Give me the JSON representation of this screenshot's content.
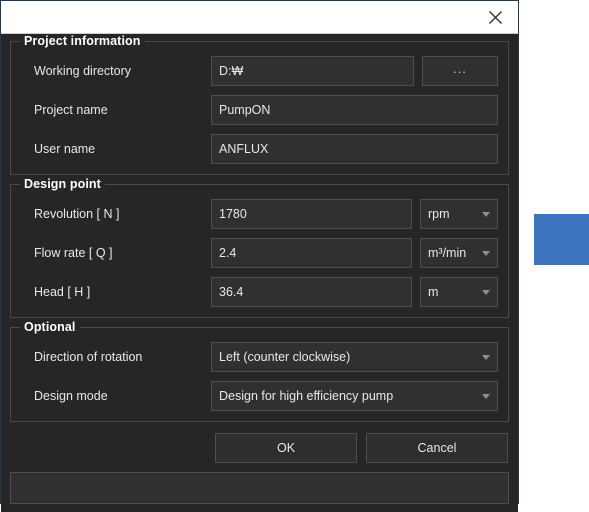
{
  "window": {
    "title": "",
    "close_icon": "close-icon"
  },
  "project_information": {
    "legend": "Project information",
    "working_directory": {
      "label": "Working directory",
      "value": "D:₩",
      "placeholder": "",
      "browse_label": "..."
    },
    "project_name": {
      "label": "Project name",
      "value": "PumpON",
      "placeholder": ""
    },
    "user_name": {
      "label": "User name",
      "value": "ANFLUX",
      "placeholder": ""
    }
  },
  "design_point": {
    "legend": "Design point",
    "revolution": {
      "label": "Revolution [ N ]",
      "value": "1780",
      "unit": "rpm"
    },
    "flow_rate": {
      "label": "Flow rate [ Q ]",
      "value": "2.4",
      "unit": "m³/min"
    },
    "head": {
      "label": "Head [ H ]",
      "value": "36.4",
      "unit": "m"
    }
  },
  "optional": {
    "legend": "Optional",
    "direction_of_rotation": {
      "label": "Direction of rotation",
      "value": "Left (counter clockwise)"
    },
    "design_mode": {
      "label": "Design mode",
      "value": "Design for high efficiency pump"
    }
  },
  "buttons": {
    "ok_label": "OK",
    "cancel_label": "Cancel"
  },
  "status_bar": {
    "text": ""
  },
  "colors": {
    "dialog_background": "#262626",
    "field_background": "#303033",
    "field_border": "#4e4e52",
    "titlebar_background": "#ffffff",
    "dialog_border": "#1b3a5c",
    "accent_block": "#3f74bf",
    "text": "#e8e8e8"
  }
}
